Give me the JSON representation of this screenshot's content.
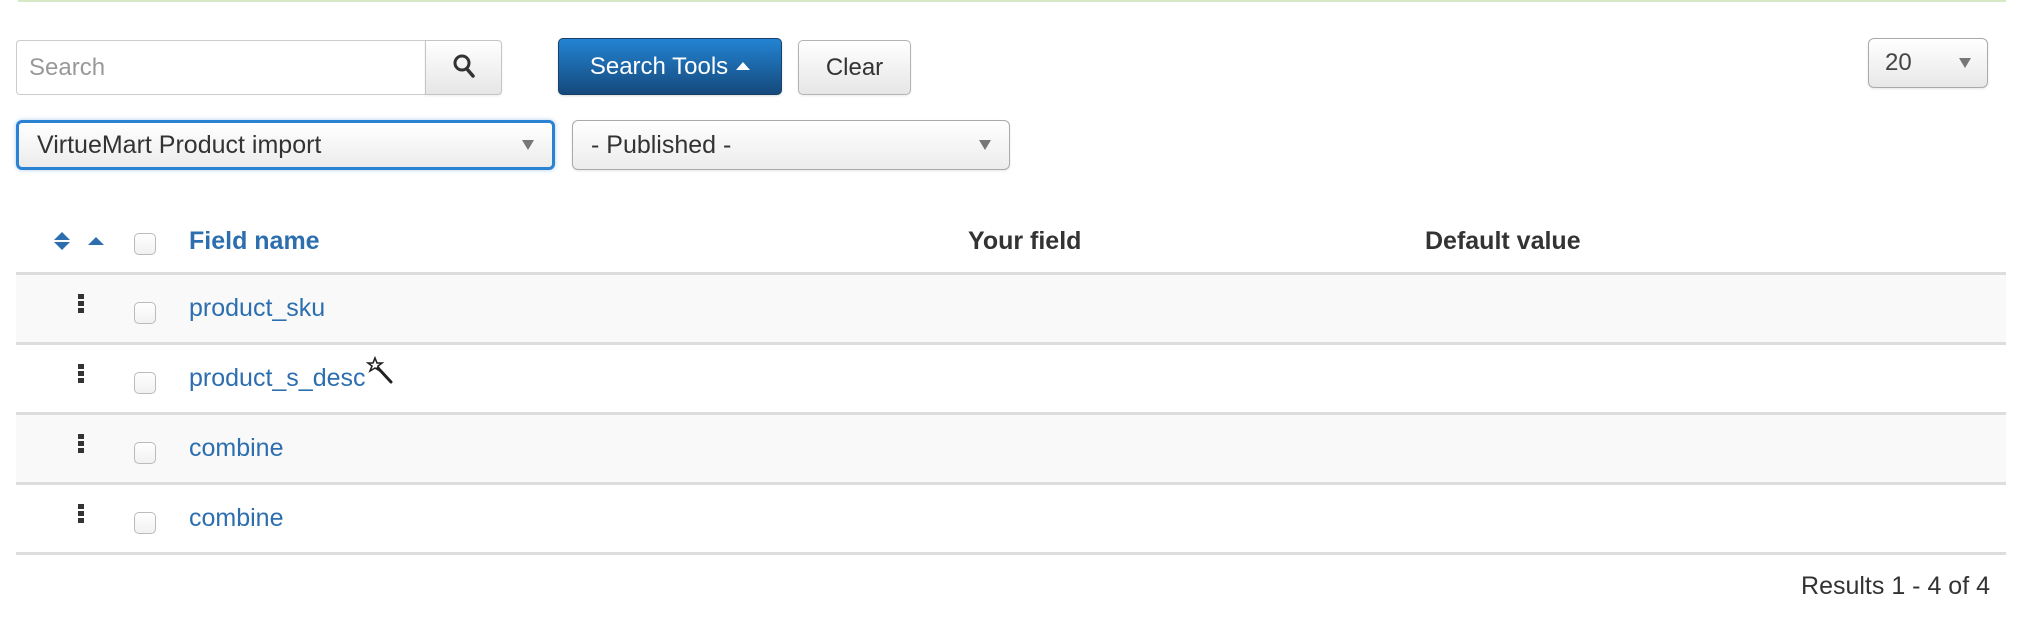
{
  "search": {
    "placeholder": "Search",
    "value": "",
    "search_button_icon": "search-icon",
    "search_tools_label": "Search Tools",
    "search_tools_icon": "caret-up-icon",
    "clear_label": "Clear"
  },
  "list_limit": {
    "selected": "20",
    "icon": "chevron-down-icon"
  },
  "filters": {
    "form": {
      "selected": "VirtueMart Product import"
    },
    "published": {
      "selected": "- Published -"
    }
  },
  "table": {
    "columns": {
      "ordering": {
        "icons": [
          "sort-icon",
          "sort-asc-icon"
        ]
      },
      "field_name": "Field name",
      "your_field": "Your field",
      "default_value": "Default value"
    },
    "rows": [
      {
        "field_name": "product_sku",
        "your_field": "",
        "default_value": "",
        "icon": null
      },
      {
        "field_name": "product_s_desc",
        "your_field": "",
        "default_value": "",
        "icon": "magic-wand-icon"
      },
      {
        "field_name": "combine",
        "your_field": "",
        "default_value": "",
        "icon": null
      },
      {
        "field_name": "combine",
        "your_field": "",
        "default_value": "",
        "icon": null
      }
    ]
  },
  "pagination": {
    "results_text": "Results 1 - 4 of 4"
  },
  "colors": {
    "link": "#2d6fae",
    "primary_button": "#1a5d9c",
    "focus_border": "#2a82d3",
    "success_bar": "#d6e9c6",
    "row_stripe": "#f9f9f9"
  }
}
